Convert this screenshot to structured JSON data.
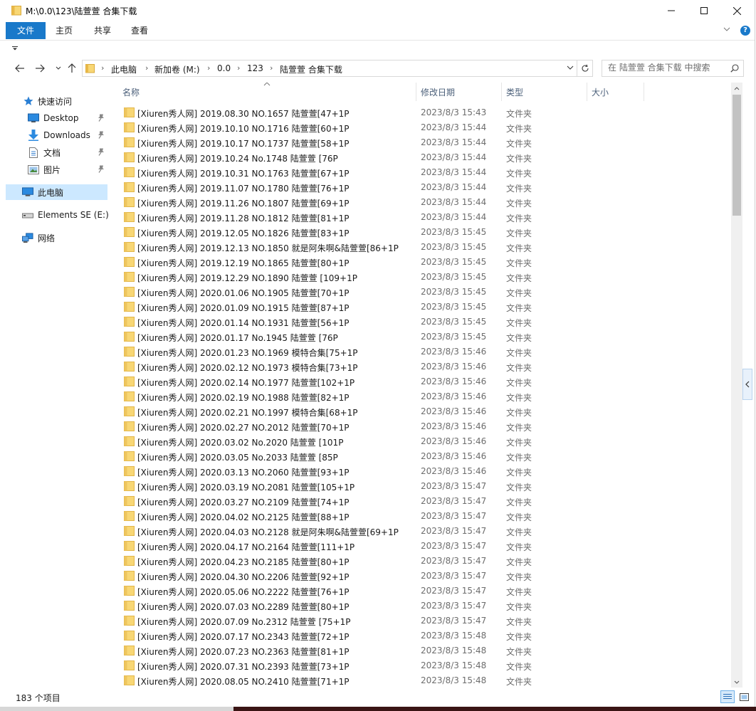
{
  "window": {
    "title": "M:\\0.0\\123\\陆萱萱 合集下载"
  },
  "ribbon": {
    "tabs": [
      {
        "label": "文件"
      },
      {
        "label": "主页"
      },
      {
        "label": "共享"
      },
      {
        "label": "查看"
      }
    ],
    "help_label": "?"
  },
  "address": {
    "breadcrumbs": [
      "此电脑",
      "新加卷 (M:)",
      "0.0",
      "123",
      "陆萱萱 合集下载"
    ]
  },
  "search": {
    "placeholder": "在 陆萱萱 合集下载 中搜索"
  },
  "sidebar": {
    "items": [
      {
        "label": "快速访问",
        "icon": "star-icon"
      },
      {
        "label": "Desktop",
        "icon": "desktop-icon",
        "pinned": true
      },
      {
        "label": "Downloads",
        "icon": "download-icon",
        "pinned": true
      },
      {
        "label": "文档",
        "icon": "document-icon",
        "pinned": true
      },
      {
        "label": "图片",
        "icon": "picture-icon",
        "pinned": true
      },
      {
        "label": "此电脑",
        "icon": "computer-icon",
        "selected": true
      },
      {
        "label": "Elements SE (E:)",
        "icon": "drive-icon"
      },
      {
        "label": "网络",
        "icon": "network-icon"
      }
    ]
  },
  "columns": {
    "name": "名称",
    "date": "修改日期",
    "type": "类型",
    "size": "大小"
  },
  "files": [
    {
      "name": "[Xiuren秀人网] 2019.08.30 NO.1657 陆萱萱[47+1P",
      "date": "2023/8/3 15:43",
      "type": "文件夹"
    },
    {
      "name": "[Xiuren秀人网] 2019.10.10 NO.1716 陆萱萱[60+1P",
      "date": "2023/8/3 15:44",
      "type": "文件夹"
    },
    {
      "name": "[Xiuren秀人网] 2019.10.17 NO.1737 陆萱萱[58+1P",
      "date": "2023/8/3 15:44",
      "type": "文件夹"
    },
    {
      "name": "[Xiuren秀人网] 2019.10.24 No.1748 陆萱萱 [76P",
      "date": "2023/8/3 15:44",
      "type": "文件夹"
    },
    {
      "name": "[Xiuren秀人网] 2019.10.31 NO.1763 陆萱萱[67+1P",
      "date": "2023/8/3 15:44",
      "type": "文件夹"
    },
    {
      "name": "[Xiuren秀人网] 2019.11.07 NO.1780 陆萱萱[76+1P",
      "date": "2023/8/3 15:44",
      "type": "文件夹"
    },
    {
      "name": "[Xiuren秀人网] 2019.11.26 NO.1807 陆萱萱[69+1P",
      "date": "2023/8/3 15:44",
      "type": "文件夹"
    },
    {
      "name": "[Xiuren秀人网] 2019.11.28 NO.1812 陆萱萱[81+1P",
      "date": "2023/8/3 15:44",
      "type": "文件夹"
    },
    {
      "name": "[Xiuren秀人网] 2019.12.05 NO.1826 陆萱萱[83+1P",
      "date": "2023/8/3 15:45",
      "type": "文件夹"
    },
    {
      "name": "[Xiuren秀人网] 2019.12.13 NO.1850 就是阿朱啊&陆萱萱[86+1P",
      "date": "2023/8/3 15:45",
      "type": "文件夹"
    },
    {
      "name": "[Xiuren秀人网] 2019.12.19 NO.1865 陆萱萱[80+1P",
      "date": "2023/8/3 15:45",
      "type": "文件夹"
    },
    {
      "name": "[Xiuren秀人网] 2019.12.29 NO.1890 陆萱萱 [109+1P",
      "date": "2023/8/3 15:45",
      "type": "文件夹"
    },
    {
      "name": "[Xiuren秀人网] 2020.01.06 NO.1905 陆萱萱[70+1P",
      "date": "2023/8/3 15:45",
      "type": "文件夹"
    },
    {
      "name": "[Xiuren秀人网] 2020.01.09 NO.1915 陆萱萱[87+1P",
      "date": "2023/8/3 15:45",
      "type": "文件夹"
    },
    {
      "name": "[Xiuren秀人网] 2020.01.14 NO.1931 陆萱萱[56+1P",
      "date": "2023/8/3 15:45",
      "type": "文件夹"
    },
    {
      "name": "[Xiuren秀人网] 2020.01.17 No.1945 陆萱萱 [76P",
      "date": "2023/8/3 15:45",
      "type": "文件夹"
    },
    {
      "name": "[Xiuren秀人网] 2020.01.23 NO.1969 模特合集[75+1P",
      "date": "2023/8/3 15:46",
      "type": "文件夹"
    },
    {
      "name": "[Xiuren秀人网] 2020.02.12 NO.1973 模特合集[73+1P",
      "date": "2023/8/3 15:46",
      "type": "文件夹"
    },
    {
      "name": "[Xiuren秀人网] 2020.02.14 NO.1977 陆萱萱[102+1P",
      "date": "2023/8/3 15:46",
      "type": "文件夹"
    },
    {
      "name": "[Xiuren秀人网] 2020.02.19 NO.1988 陆萱萱[82+1P",
      "date": "2023/8/3 15:46",
      "type": "文件夹"
    },
    {
      "name": "[Xiuren秀人网] 2020.02.21 NO.1997 模特合集[68+1P",
      "date": "2023/8/3 15:46",
      "type": "文件夹"
    },
    {
      "name": "[Xiuren秀人网] 2020.02.27 NO.2012 陆萱萱[70+1P",
      "date": "2023/8/3 15:46",
      "type": "文件夹"
    },
    {
      "name": "[Xiuren秀人网] 2020.03.02 No.2020 陆萱萱 [101P",
      "date": "2023/8/3 15:46",
      "type": "文件夹"
    },
    {
      "name": "[Xiuren秀人网] 2020.03.05 No.2033 陆萱萱 [85P",
      "date": "2023/8/3 15:46",
      "type": "文件夹"
    },
    {
      "name": "[Xiuren秀人网] 2020.03.13 NO.2060 陆萱萱[93+1P",
      "date": "2023/8/3 15:46",
      "type": "文件夹"
    },
    {
      "name": "[Xiuren秀人网] 2020.03.19 NO.2081 陆萱萱[105+1P",
      "date": "2023/8/3 15:47",
      "type": "文件夹"
    },
    {
      "name": "[Xiuren秀人网] 2020.03.27 NO.2109 陆萱萱[74+1P",
      "date": "2023/8/3 15:47",
      "type": "文件夹"
    },
    {
      "name": "[Xiuren秀人网] 2020.04.02 NO.2125 陆萱萱[88+1P",
      "date": "2023/8/3 15:47",
      "type": "文件夹"
    },
    {
      "name": "[Xiuren秀人网] 2020.04.03 NO.2128 就是阿朱啊&陆萱萱[69+1P",
      "date": "2023/8/3 15:47",
      "type": "文件夹"
    },
    {
      "name": "[Xiuren秀人网] 2020.04.17 NO.2164 陆萱萱[111+1P",
      "date": "2023/8/3 15:47",
      "type": "文件夹"
    },
    {
      "name": "[Xiuren秀人网] 2020.04.23 NO.2185 陆萱萱[80+1P",
      "date": "2023/8/3 15:47",
      "type": "文件夹"
    },
    {
      "name": "[Xiuren秀人网] 2020.04.30 NO.2206 陆萱萱[92+1P",
      "date": "2023/8/3 15:47",
      "type": "文件夹"
    },
    {
      "name": "[Xiuren秀人网] 2020.05.06 NO.2222 陆萱萱[76+1P",
      "date": "2023/8/3 15:47",
      "type": "文件夹"
    },
    {
      "name": "[Xiuren秀人网] 2020.07.03 NO.2289 陆萱萱[80+1P",
      "date": "2023/8/3 15:47",
      "type": "文件夹"
    },
    {
      "name": "[Xiuren秀人网] 2020.07.09 No.2312 陆萱萱 [75+1P",
      "date": "2023/8/3 15:47",
      "type": "文件夹"
    },
    {
      "name": "[Xiuren秀人网] 2020.07.17 NO.2343 陆萱萱[72+1P",
      "date": "2023/8/3 15:48",
      "type": "文件夹"
    },
    {
      "name": "[Xiuren秀人网] 2020.07.23 NO.2363 陆萱萱[81+1P",
      "date": "2023/8/3 15:48",
      "type": "文件夹"
    },
    {
      "name": "[Xiuren秀人网] 2020.07.31 NO.2393 陆萱萱[73+1P",
      "date": "2023/8/3 15:48",
      "type": "文件夹"
    },
    {
      "name": "[Xiuren秀人网] 2020.08.05 NO.2410 陆萱萱[71+1P",
      "date": "2023/8/3 15:48",
      "type": "文件夹"
    }
  ],
  "status": {
    "item_count": "183 个项目"
  },
  "colors": {
    "accent": "#1979ca",
    "folder": "#f8d775",
    "selection": "#cce8ff",
    "header_text": "#4c607a",
    "muted_text": "#6d6d6d"
  }
}
